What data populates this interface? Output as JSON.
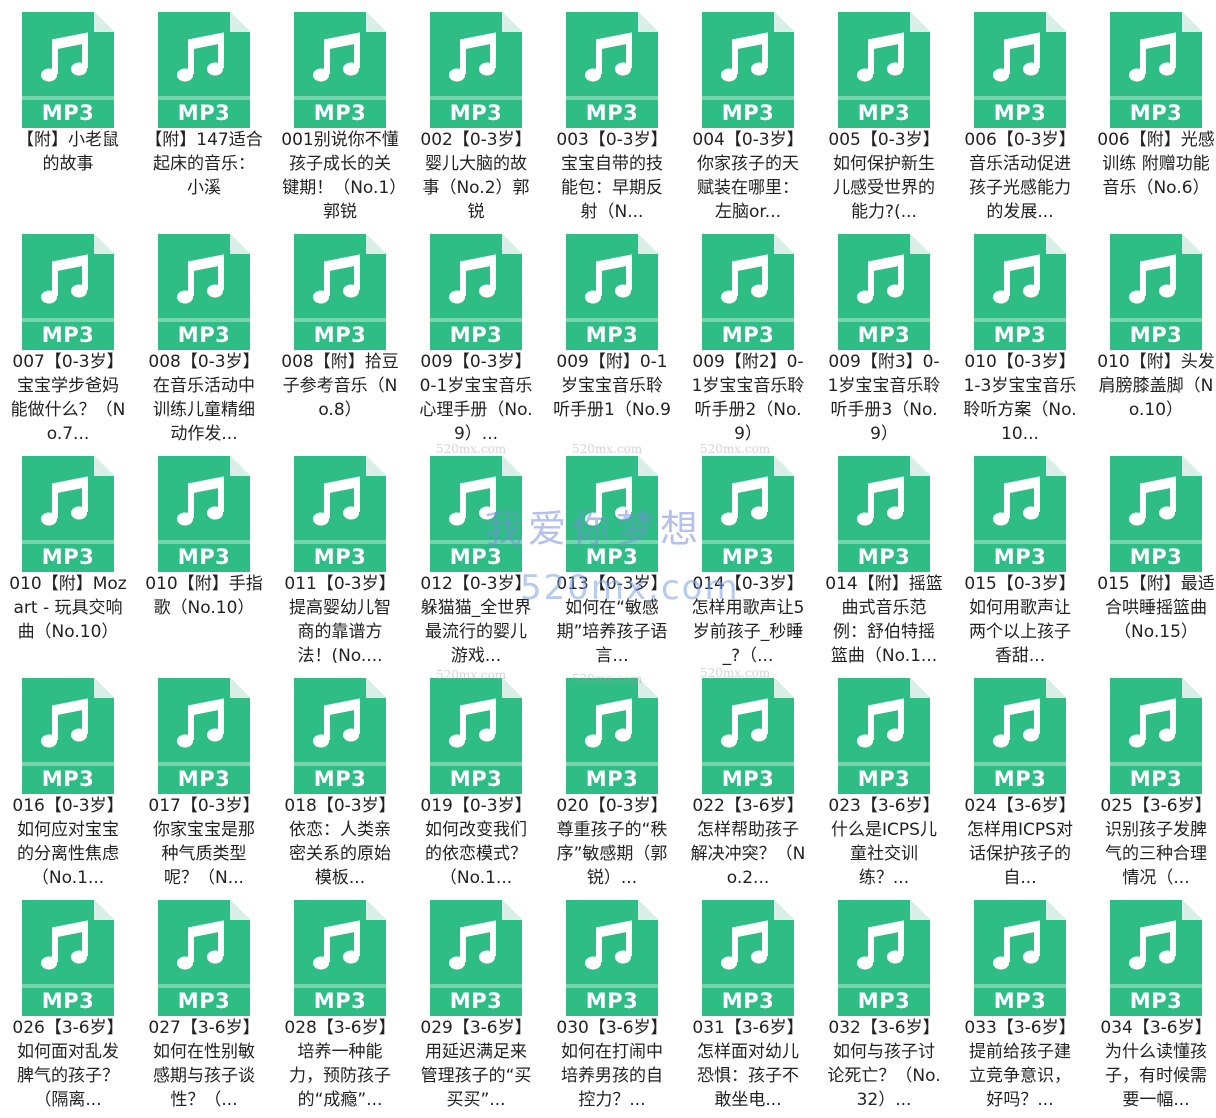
{
  "file_type_label": "MP3",
  "icon": "music-note-icon",
  "colors": {
    "icon_green": "#2dbd85",
    "icon_fold": "#d9eee6",
    "text": "#222222"
  },
  "files": [
    "【附】小老鼠的故事",
    "【附】147适合起床的音乐：小溪",
    "001别说你不懂孩子成长的关键期！（No.1）郭锐",
    "002【0-3岁】婴儿大脑的故事（No.2）郭锐",
    "003【0-3岁】宝宝自带的技能包：早期反射（N...",
    "004【0-3岁】你家孩子的天赋装在哪里：左脑or...",
    "005【0-3岁】如何保护新生儿感受世界的能力?(...",
    "006【0-3岁】音乐活动促进孩子光感能力的发展...",
    "006【附】光感训练 附赠功能音乐（No.6）",
    "007【0-3岁】宝宝学步爸妈能做什么？（No.7...",
    "008【0-3岁】在音乐活动中训练儿童精细动作发...",
    "008【附】拾豆子参考音乐（No.8）",
    "009【0-3岁】0-1岁宝宝音乐心理手册（No.9）...",
    "009【附】0-1岁宝宝音乐聆听手册1（No.9",
    "009【附2】0-1岁宝宝音乐聆听手册2（No.9）",
    "009【附3】0-1岁宝宝音乐聆听手册3（No.9）",
    "010【0-3岁】1-3岁宝宝音乐聆听方案（No.10...",
    "010【附】头发肩膀膝盖脚（No.10）",
    "010【附】Mozart - 玩具交响曲（No.10）",
    "010【附】手指歌（No.10）",
    "011【0-3岁】提高婴幼儿智商的靠谱方法！(No....",
    "012【0-3岁】躲猫猫_全世界最流行的婴儿游戏...",
    "013【0-3岁】如何在“敏感期”培养孩子语言...",
    "014【0-3岁】怎样用歌声让5岁前孩子_秒睡_?（...",
    "014【附】摇篮曲式音乐范例：舒伯特摇篮曲（No.1...",
    "015【0-3岁】如何用歌声让两个以上孩子香甜...",
    "015【附】最适合哄睡摇篮曲（No.15）",
    "016【0-3岁】如何应对宝宝的分离性焦虑（No.1...",
    "017【0-3岁】你家宝宝是那种气质类型呢？（N...",
    "018【0-3岁】依恋：人类亲密关系的原始模板...",
    "019【0-3岁】如何改变我们的依恋模式？（No.1...",
    "020【0-3岁】尊重孩子的“秩序”敏感期（郭锐）...",
    "022【3-6岁】怎样帮助孩子解决冲突？（No.2...",
    "023【3-6岁】什么是ICPS儿童社交训练？...",
    "024【3-6岁】怎样用ICPS对话保护孩子的自...",
    "025【3-6岁】识别孩子发脾气的三种合理情况（...",
    "026【3-6岁】如何面对乱发脾气的孩子？（隔离...",
    "027【3-6岁】如何在性别敏感期与孩子谈性？（...",
    "028【3-6岁】培养一种能力，预防孩子的“成瘾”...",
    "029【3-6岁】用延迟满足来管理孩子的“买买买”...",
    "030【3-6岁】如何在打闹中培养男孩的自控力？...",
    "031【3-6岁】怎样面对幼儿恐惧：孩子不敢坐电...",
    "032【3-6岁】如何与孩子讨论死亡？（No.32）...",
    "033【3-6岁】提前给孩子建立竞争意识，好吗？...",
    "034【3-6岁】为什么读懂孩子，有时候需要一幅..."
  ],
  "watermark": {
    "chinese": "我爱你梦想",
    "url": "520mx.com",
    "small": "520mx.com"
  }
}
